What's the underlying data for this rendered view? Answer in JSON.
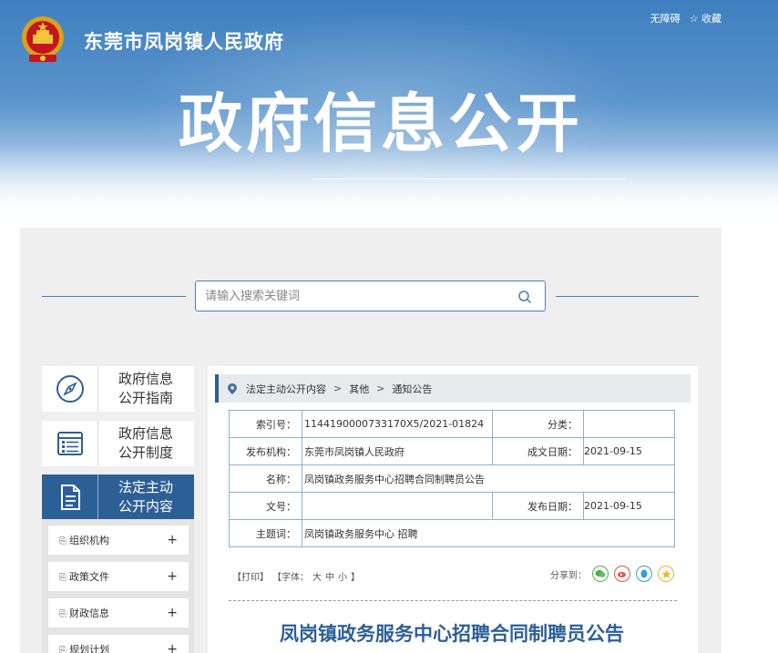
{
  "header": {
    "site_title": "东莞市凤岗镇人民政府",
    "accessibility_link": "无障碍",
    "favorite_link": "☆ 收藏",
    "banner_title": "政府信息公开"
  },
  "search": {
    "placeholder": "请输入搜索关键词"
  },
  "sidebar": {
    "cards": [
      {
        "line1": "政府信息",
        "line2": "公开指南",
        "icon": "compass-icon"
      },
      {
        "line1": "政府信息",
        "line2": "公开制度",
        "icon": "list-document-icon"
      },
      {
        "line1": "法定主动",
        "line2": "公开内容",
        "icon": "document-icon"
      }
    ],
    "submenu": [
      {
        "label": "组织机构",
        "plus": "+"
      },
      {
        "label": "政策文件",
        "plus": "+"
      },
      {
        "label": "财政信息",
        "plus": "+"
      },
      {
        "label": "规划计划",
        "plus": "+"
      }
    ]
  },
  "breadcrumb": {
    "items": [
      "法定主动公开内容",
      "其他",
      "通知公告"
    ],
    "separator": ">"
  },
  "meta": {
    "index_label": "索引号：",
    "index_value": "1144190000733170X5/2021-01824",
    "category_label": "分类：",
    "category_value": "",
    "publisher_label": "发布机构：",
    "publisher_value": "东莞市凤岗镇人民政府",
    "created_label": "成文日期：",
    "created_value": "2021-09-15",
    "name_label": "名称：",
    "name_value": "凤岗镇政务服务中心招聘合同制聘员公告",
    "docno_label": "文号：",
    "docno_value": "",
    "published_label": "发布日期：",
    "published_value": "2021-09-15",
    "subject_label": "主题词：",
    "subject_value": "凤岗镇政务服务中心 招聘"
  },
  "tools": {
    "print": "【打印】",
    "font_prefix": "【字体：",
    "font_large": "大",
    "font_medium": "中",
    "font_small": "小",
    "font_suffix": "】"
  },
  "share": {
    "label": "分享到：",
    "icons": [
      "wechat-icon",
      "weibo-icon",
      "qq-icon",
      "qzone-icon"
    ]
  },
  "article": {
    "title": "凤岗镇政务服务中心招聘合同制聘员公告"
  },
  "colors": {
    "accent": "#2d5f97",
    "border": "#8ab0d6"
  }
}
